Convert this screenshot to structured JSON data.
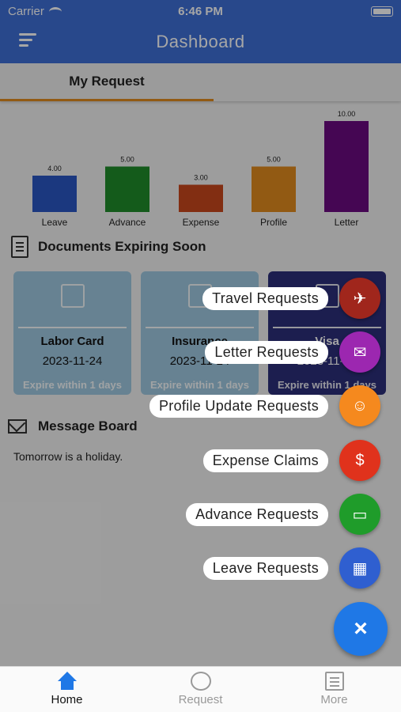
{
  "status_bar": {
    "carrier": "Carrier",
    "time": "6:46 PM"
  },
  "header": {
    "title": "Dashboard"
  },
  "tabs": [
    {
      "label": "My Request",
      "active": true
    }
  ],
  "chart_data": {
    "type": "bar",
    "categories": [
      "Leave",
      "Advance",
      "Expense",
      "Profile",
      "Letter"
    ],
    "values": [
      4.0,
      5.0,
      3.0,
      5.0,
      10.0
    ],
    "value_labels": [
      "4.00",
      "5.00",
      "3.00",
      "5.00",
      "10.00"
    ],
    "colors": [
      "#2a57c4",
      "#1f8c2a",
      "#c8471c",
      "#e08a1e",
      "#6a0a80"
    ],
    "ylim": [
      0,
      10
    ],
    "grid": false
  },
  "documents": {
    "title": "Documents Expiring Soon",
    "cards": [
      {
        "name": "Labor Card",
        "date": "2023-11-24",
        "expiry": "Expire within 1 days",
        "color": "#9fc8e0"
      },
      {
        "name": "Insurance",
        "date": "2023-11-24",
        "expiry": "Expire within 1 days",
        "color": "#9fc8e0"
      },
      {
        "name": "Visa",
        "date": "2023-11-24",
        "expiry": "Expire within 1 days",
        "color": "#2b2e7a"
      }
    ]
  },
  "message_board": {
    "title": "Message Board",
    "text": "Tomorrow is a holiday."
  },
  "fab_actions": [
    {
      "label": "Travel Requests",
      "icon": "travel-icon",
      "color": "#a0261c"
    },
    {
      "label": "Letter Requests",
      "icon": "letter-icon",
      "color": "#9c27b0"
    },
    {
      "label": "Profile Update Requests",
      "icon": "profile-icon",
      "color": "#f5891e"
    },
    {
      "label": "Expense Claims",
      "icon": "expense-icon",
      "color": "#e0321c"
    },
    {
      "label": "Advance Requests",
      "icon": "advance-icon",
      "color": "#1f9c2a"
    },
    {
      "label": "Leave Requests",
      "icon": "calendar-icon",
      "color": "#2f5fd0"
    }
  ],
  "fab_main": {
    "symbol": "×",
    "color": "#1f78e6"
  },
  "bottom_nav": [
    {
      "label": "Home",
      "icon": "home-icon",
      "active": true
    },
    {
      "label": "Request",
      "icon": "request-icon",
      "active": false
    },
    {
      "label": "More",
      "icon": "more-icon",
      "active": false
    }
  ]
}
